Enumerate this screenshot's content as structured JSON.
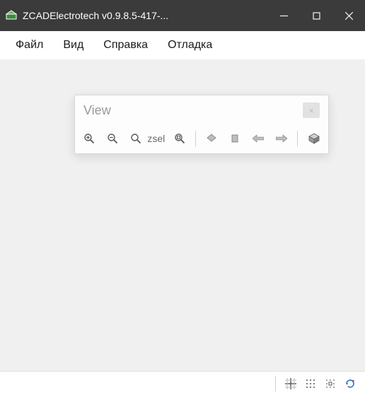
{
  "window": {
    "title": "ZCADElectrotech v0.9.8.5-417-..."
  },
  "menubar": {
    "items": [
      {
        "label": "Файл"
      },
      {
        "label": "Вид"
      },
      {
        "label": "Справка"
      },
      {
        "label": "Отладка"
      }
    ]
  },
  "view_panel": {
    "title": "View",
    "close_label": "×",
    "toolbar": {
      "zoom_in": "zoom-in",
      "zoom_out": "zoom-out",
      "zoom_all": "zoom-extents",
      "zsel_label": "zsel",
      "zoom_sel": "zoom-selection",
      "view_top": "view-top",
      "view_front": "view-front",
      "view_left": "view-left",
      "view_right": "view-right",
      "view_iso": "view-isometric"
    }
  },
  "statusbar": {
    "snap_grid": "snap-grid",
    "snap_entity": "snap-entity",
    "polar": "polar-tracking",
    "redraw": "redraw"
  }
}
